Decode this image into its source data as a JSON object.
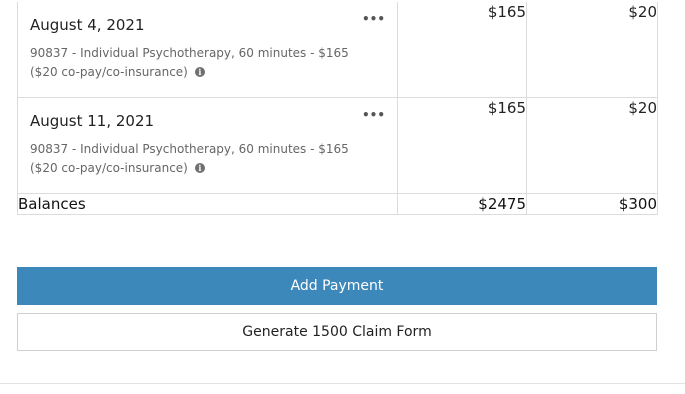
{
  "ledger": {
    "rows": [
      {
        "date": "August 4, 2021",
        "service": "90837 - Individual Psychotherapy, 60 minutes - $165 ($20 co-pay/co-insurance)",
        "fee": "$165",
        "paid": "$20",
        "more_icon": "ellipsis-icon",
        "info_icon": "info-icon"
      },
      {
        "date": "August 11, 2021",
        "service": "90837 - Individual Psychotherapy, 60 minutes - $165 ($20 co-pay/co-insurance)",
        "fee": "$165",
        "paid": "$20",
        "more_icon": "ellipsis-icon",
        "info_icon": "info-icon"
      }
    ],
    "balances": {
      "label": "Balances",
      "fee_total": "$2475",
      "paid_total": "$300"
    }
  },
  "actions": {
    "add_payment_label": "Add Payment",
    "generate_claim_label": "Generate 1500 Claim Form"
  },
  "colors": {
    "primary_button": "#3d88bb",
    "border": "#dcdcdc",
    "muted_text": "#666666"
  }
}
